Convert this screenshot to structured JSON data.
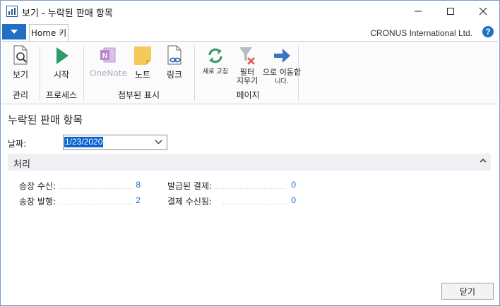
{
  "window": {
    "title": "보기 - 누락된 판매 항목",
    "minimize_icon": "minimize-icon",
    "maximize_icon": "maximize-icon",
    "close_icon": "close-icon"
  },
  "ribbon": {
    "tab_home": "Home 키",
    "company": "CRONUS International Ltd.",
    "help_icon": "?",
    "groups": {
      "manage": {
        "label": "관리",
        "view": "보기"
      },
      "process": {
        "label": "프로세스",
        "start": "시작"
      },
      "attachments": {
        "label": "첨부된 표시",
        "onenote": "OneNote",
        "notes": "노트",
        "links": "링크"
      },
      "page": {
        "label": "페이지",
        "refresh": "새로 고침",
        "clear_filter_1": "필터",
        "clear_filter_2": "지우기",
        "goto_1": "으로 이동합",
        "goto_2": "니다."
      }
    }
  },
  "main": {
    "page_title": "누락된 판매 항목",
    "date_label": "날짜:",
    "date_value": "1/23/2020",
    "fasttab_title": "처리",
    "fields": {
      "invoices_received_label": "송장 수신:",
      "invoices_received_value": "8",
      "invoices_issued_label": "송장 발행:",
      "invoices_issued_value": "2",
      "payments_issued_label": "발급된 결제:",
      "payments_issued_value": "0",
      "payments_received_label": "결제 수신됨:",
      "payments_received_value": "0"
    },
    "close_button": "닫기"
  },
  "colors": {
    "accent": "#1f6fc4",
    "selection": "#0a64d0"
  }
}
